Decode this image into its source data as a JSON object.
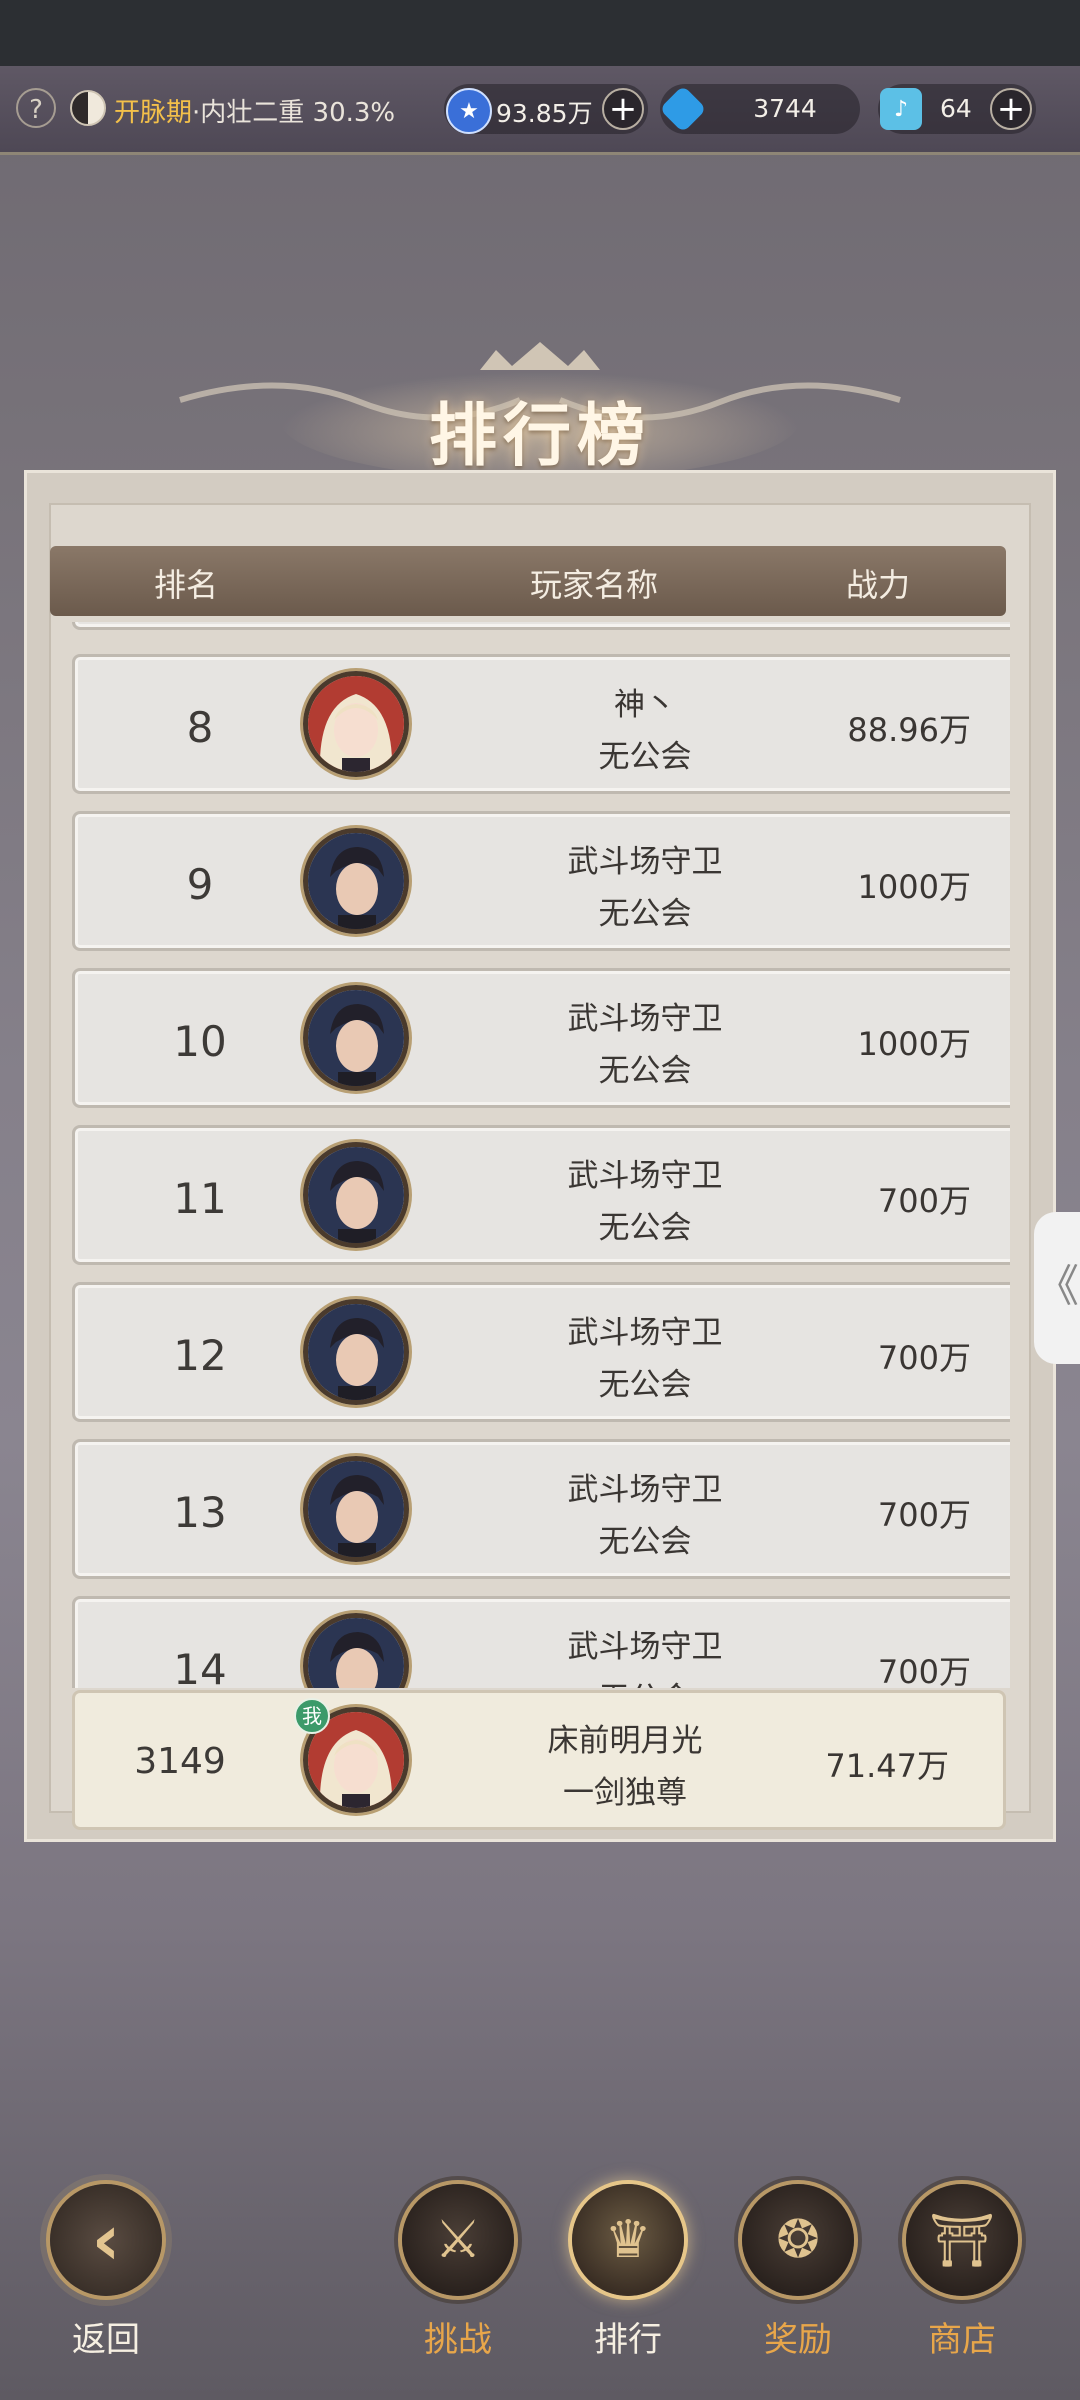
{
  "topbar": {
    "help": "?",
    "realm_stage": "开脉期",
    "realm_detail": "·内壮二重 30.3%",
    "resources": [
      {
        "icon": "star-coin-icon",
        "value": "93.85万",
        "color": "#3a6fd8"
      },
      {
        "icon": "blue-gem-icon",
        "value": "3744",
        "color": "#2e9be6"
      },
      {
        "icon": "jade-ticket-icon",
        "value": "64",
        "color": "#6fd0f0"
      }
    ],
    "plus": "+"
  },
  "title": "排行榜",
  "table": {
    "headers": {
      "rank": "排名",
      "name": "玩家名称",
      "power": "战力"
    },
    "rows": [
      {
        "rank": "8",
        "name": "神丶",
        "guild": "无公会",
        "power": "88.96万",
        "avatar": "female"
      },
      {
        "rank": "9",
        "name": "武斗场守卫",
        "guild": "无公会",
        "power": "1000万",
        "avatar": "guard"
      },
      {
        "rank": "10",
        "name": "武斗场守卫",
        "guild": "无公会",
        "power": "1000万",
        "avatar": "guard"
      },
      {
        "rank": "11",
        "name": "武斗场守卫",
        "guild": "无公会",
        "power": "700万",
        "avatar": "guard"
      },
      {
        "rank": "12",
        "name": "武斗场守卫",
        "guild": "无公会",
        "power": "700万",
        "avatar": "guard"
      },
      {
        "rank": "13",
        "name": "武斗场守卫",
        "guild": "无公会",
        "power": "700万",
        "avatar": "guard"
      },
      {
        "rank": "14",
        "name": "武斗场守卫",
        "guild": "无公会",
        "power": "700万",
        "avatar": "guard"
      }
    ]
  },
  "my_rank": {
    "badge": "我",
    "rank": "3149",
    "name": "床前明月光",
    "guild": "一剑独尊",
    "power": "71.47万"
  },
  "side_tab": "《",
  "nav": {
    "back": "返回",
    "challenge": "挑战",
    "ranking": "排行",
    "rewards": "奖励",
    "shop": "商店"
  }
}
